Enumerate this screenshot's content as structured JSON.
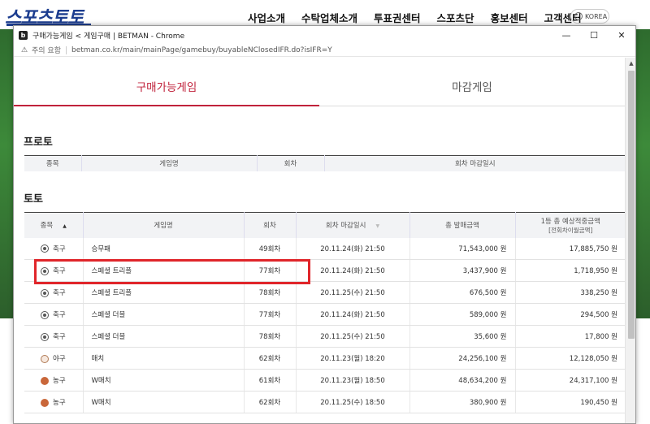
{
  "site": {
    "logo": "스포츠토토",
    "nav": [
      "사업소개",
      "수탁업체소개",
      "투표권센터",
      "스포츠단",
      "홍보센터",
      "고객센터"
    ],
    "lang": "KOREA"
  },
  "window": {
    "title": "구매가능게임 < 게임구매 | BETMAN - Chrome",
    "controls": {
      "minimize": "—",
      "maximize": "☐",
      "close": "✕"
    }
  },
  "address": {
    "warning": "주의 요함",
    "url": "betman.co.kr/main/mainPage/gamebuy/buyableNClosedIFR.do?isIFR=Y"
  },
  "tabs": [
    {
      "label": "구매가능게임",
      "active": true
    },
    {
      "label": "마감게임",
      "active": false
    }
  ],
  "proto": {
    "title": "프로토",
    "headers": [
      "종목",
      "게임명",
      "회차",
      "회차 마감일시"
    ]
  },
  "toto": {
    "title": "토토",
    "headers": {
      "sport": "종목",
      "name": "게임명",
      "round": "회차",
      "deadline": "회차 마감일시",
      "sales": "총 발매금액",
      "prize": "1등 총 예상적중금액",
      "prize_sub": "[전회차이월금액]"
    },
    "rows": [
      {
        "sport": "축구",
        "icon": "soccer-icon",
        "name": "승무패",
        "round": "49회차",
        "deadline": "20.11.24(화) 21:50",
        "sales": "71,543,000 원",
        "prize": "17,885,750 원"
      },
      {
        "sport": "축구",
        "icon": "soccer-icon",
        "name": "스페셜 트리플",
        "round": "77회차",
        "deadline": "20.11.24(화) 21:50",
        "sales": "3,437,900 원",
        "prize": "1,718,950 원"
      },
      {
        "sport": "축구",
        "icon": "soccer-icon",
        "name": "스페셜 트리플",
        "round": "78회차",
        "deadline": "20.11.25(수) 21:50",
        "sales": "676,500 원",
        "prize": "338,250 원"
      },
      {
        "sport": "축구",
        "icon": "soccer-icon",
        "name": "스페셜 더블",
        "round": "77회차",
        "deadline": "20.11.24(화) 21:50",
        "sales": "589,000 원",
        "prize": "294,500 원"
      },
      {
        "sport": "축구",
        "icon": "soccer-icon",
        "name": "스페셜 더블",
        "round": "78회차",
        "deadline": "20.11.25(수) 21:50",
        "sales": "35,600 원",
        "prize": "17,800 원"
      },
      {
        "sport": "야구",
        "icon": "baseball-icon",
        "name": "매치",
        "round": "62회차",
        "deadline": "20.11.23(월) 18:20",
        "sales": "24,256,100 원",
        "prize": "12,128,050 원"
      },
      {
        "sport": "농구",
        "icon": "basketball-icon",
        "name": "W매치",
        "round": "61회차",
        "deadline": "20.11.23(월) 18:50",
        "sales": "48,634,200 원",
        "prize": "24,317,100 원"
      },
      {
        "sport": "농구",
        "icon": "basketball-icon",
        "name": "W매치",
        "round": "62회차",
        "deadline": "20.11.25(수) 18:50",
        "sales": "380,900 원",
        "prize": "190,450 원"
      }
    ]
  }
}
